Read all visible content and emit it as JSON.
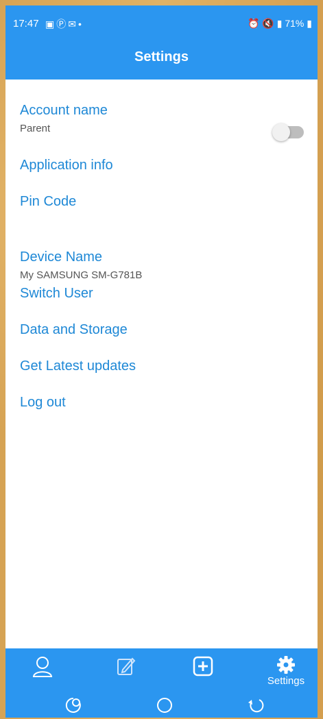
{
  "status_bar": {
    "time": "17:47",
    "left_icons": [
      "gallery-icon",
      "pinterest-icon",
      "gmail-icon",
      "dot-icon"
    ],
    "battery": "71%"
  },
  "app_bar": {
    "title": "Settings"
  },
  "settings_items": [
    {
      "label": "Account name",
      "value": "Parent"
    },
    {
      "label": "Application info"
    },
    {
      "label": "Pin Code",
      "toggle": false
    },
    {
      "label": "Device Name",
      "value": "My SAMSUNG SM-G781B"
    },
    {
      "label": "Switch User"
    },
    {
      "label": "Data and Storage"
    },
    {
      "label": "Get Latest updates"
    },
    {
      "label": "Log out"
    }
  ],
  "bottom_tabs": [
    {
      "icon": "person-icon"
    },
    {
      "icon": "edit-icon"
    },
    {
      "icon": "add-box-icon"
    },
    {
      "icon": "gear-icon",
      "label": "Settings"
    }
  ],
  "system_nav": [
    "recent-apps-icon",
    "home-icon",
    "back-icon"
  ],
  "colors": {
    "primary": "#2b96f0",
    "link": "#1e88d6",
    "subtext": "#555555"
  }
}
